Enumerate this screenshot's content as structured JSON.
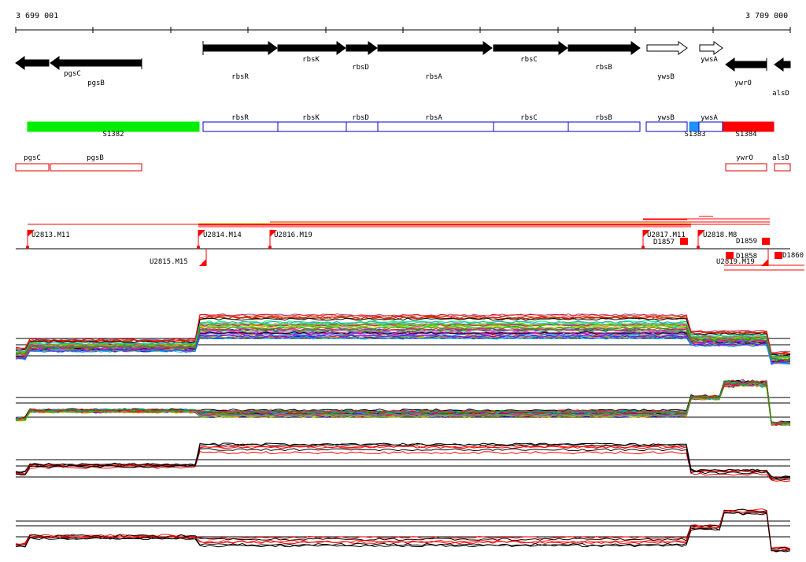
{
  "coords": {
    "start": "3 699 001",
    "end": "3 709 000"
  },
  "genes": [
    {
      "name": "pgsC",
      "strand": "-",
      "filled": true
    },
    {
      "name": "pgsB",
      "strand": "-",
      "filled": true
    },
    {
      "name": "rbsR",
      "strand": "+",
      "filled": true
    },
    {
      "name": "rbsK",
      "strand": "+",
      "filled": true
    },
    {
      "name": "rbsD",
      "strand": "+",
      "filled": true
    },
    {
      "name": "rbsA",
      "strand": "+",
      "filled": true
    },
    {
      "name": "rbsC",
      "strand": "+",
      "filled": true
    },
    {
      "name": "rbsB",
      "strand": "+",
      "filled": true
    },
    {
      "name": "ywsB",
      "strand": "+",
      "filled": false
    },
    {
      "name": "ywsA",
      "strand": "+",
      "filled": false
    },
    {
      "name": "ywrO",
      "strand": "-",
      "filled": true
    },
    {
      "name": "alsD",
      "strand": "-",
      "filled": true
    }
  ],
  "operon_row": {
    "blocks": [
      {
        "name": "S1382",
        "color": "#00ee00"
      },
      {
        "name": "S1383",
        "color": "#1e90ff"
      },
      {
        "name": "S1384",
        "color": "#ff0000"
      }
    ],
    "genes": [
      "rbsR",
      "rbsK",
      "rbsD",
      "rbsA",
      "rbsC",
      "rbsB",
      "ywsB",
      "ywsA"
    ],
    "gene_color": "#0000cc"
  },
  "antisense_row": {
    "genes": [
      "pgsC",
      "pgsB",
      "ywrO",
      "alsD"
    ],
    "color": "#dd0000"
  },
  "transcription_units": [
    "U2813.M11",
    "U2814.M14",
    "U2815.M15",
    "U2816.M19",
    "U2817.M11",
    "U2818.M8",
    "U2819.M19",
    "D1857",
    "D1858",
    "D1859",
    "D1860"
  ],
  "colors": {
    "gene_fill": "#000000",
    "tu_marker": "#ff0000",
    "axis": "#000000"
  },
  "expression_panels": [
    {
      "id": "panel1",
      "type": "multicolor",
      "profile": "high-rbs"
    },
    {
      "id": "panel2",
      "type": "multicolor",
      "profile": "low-flat"
    },
    {
      "id": "panel3",
      "type": "red-black",
      "profile": "high-rbs"
    },
    {
      "id": "panel4",
      "type": "red-black",
      "profile": "low-flat"
    }
  ]
}
